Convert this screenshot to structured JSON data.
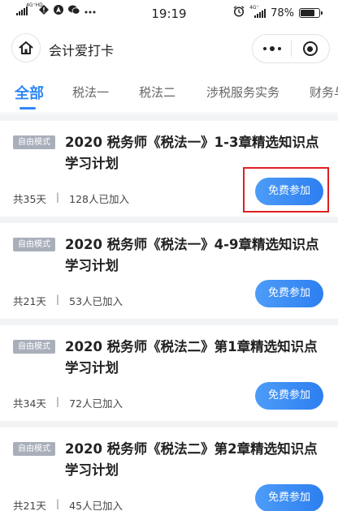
{
  "status_bar": {
    "network_label": "4G⁺HD",
    "time": "19:19",
    "network_right": "4G⁺",
    "battery_percent": "78%",
    "battery_level": 0.78,
    "icons": [
      "signal-icon",
      "alert-icon",
      "navigation-icon",
      "wechat-icon",
      "more-dots-icon",
      "alarm-icon",
      "signal-icon",
      "battery-icon"
    ]
  },
  "nav": {
    "title": "会计爱打卡"
  },
  "tabs": [
    {
      "label": "全部",
      "active": true
    },
    {
      "label": "税法一",
      "active": false
    },
    {
      "label": "税法二",
      "active": false
    },
    {
      "label": "涉税服务实务",
      "active": false
    },
    {
      "label": "财务与",
      "active": false
    }
  ],
  "cards": [
    {
      "badge": "自由模式",
      "title": "2020 税务师《税法一》1-3章精选知识点学习计划",
      "days": "共35天",
      "joined": "128人已加入",
      "button": "免费参加",
      "highlighted": true
    },
    {
      "badge": "自由模式",
      "title": "2020 税务师《税法一》4-9章精选知识点学习计划",
      "days": "共21天",
      "joined": "53人已加入",
      "button": "免费参加",
      "highlighted": false
    },
    {
      "badge": "自由模式",
      "title": "2020 税务师《税法二》第1章精选知识点学习计划",
      "days": "共34天",
      "joined": "72人已加入",
      "button": "免费参加",
      "highlighted": false
    },
    {
      "badge": "自由模式",
      "title": "2020 税务师《税法二》第2章精选知识点学习计划",
      "days": "共21天",
      "joined": "45人已加入",
      "button": "免费参加",
      "highlighted": false
    }
  ],
  "meta_separator": "|",
  "colors": {
    "accent": "#2f86f6",
    "badge": "#a9afba",
    "highlight": "#e02020"
  }
}
